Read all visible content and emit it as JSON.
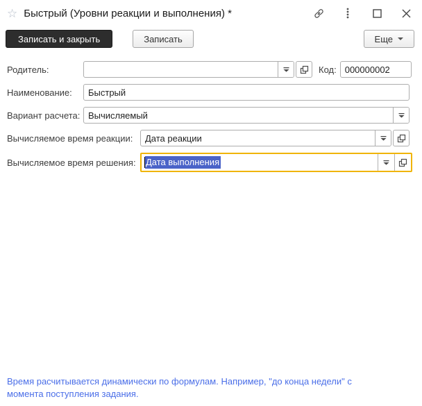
{
  "titlebar": {
    "title": "Быстрый (Уровни реакции и выполнения) *",
    "icons": {
      "favorite": "star-outline",
      "link": "chain-link",
      "menu": "vertical-dots",
      "maximize": "square-outline",
      "close": "x-cross"
    }
  },
  "toolbar": {
    "save_close_label": "Записать и закрыть",
    "save_label": "Записать",
    "more_label": "Еще"
  },
  "form": {
    "parent_label": "Родитель:",
    "parent_value": "",
    "code_label": "Код:",
    "code_value": "000000002",
    "name_label": "Наименование:",
    "name_value": "Быстрый",
    "calc_variant_label": "Вариант расчета:",
    "calc_variant_value": "Вычисляемый",
    "reaction_label": "Вычисляемое время реакции:",
    "reaction_value": "Дата реакции",
    "resolution_label": "Вычисляемое время решения:",
    "resolution_value": "Дата выполнения",
    "resolution_state": "selected-text, field focused"
  },
  "hint": "Время расчитывается динамически по формулам. Например, \"до конца недели\" с момента поступления задания.",
  "colors": {
    "focus_border": "#f0b400",
    "selection_bg": "#4a63c8",
    "hint_text": "#4a6ee8",
    "primary_button_bg": "#2d2d2d"
  }
}
